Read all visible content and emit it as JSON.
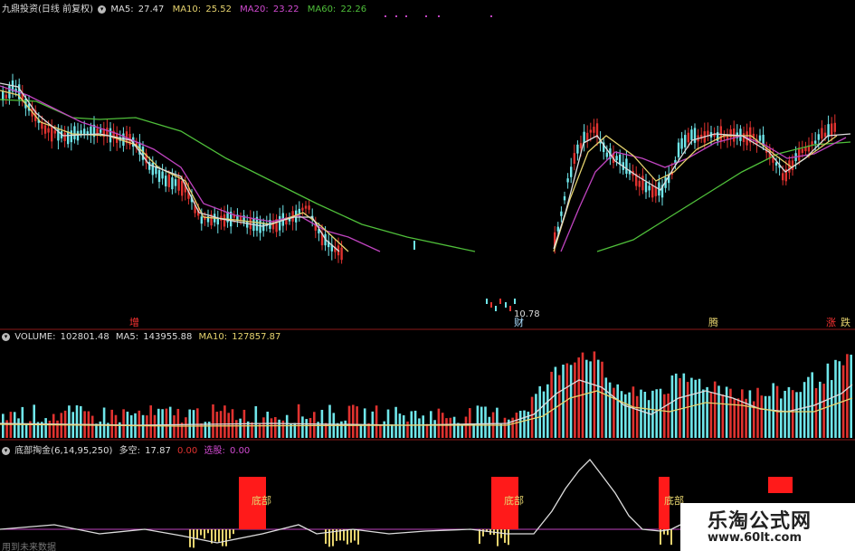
{
  "colors": {
    "ma5": "#dddddd",
    "ma10": "#e6d36e",
    "ma20": "#c044c0",
    "ma60": "#4fbf3a",
    "up": "#e0322f",
    "down": "#6fe6ea",
    "label": "#ff3333",
    "sep": "#8b1a1a"
  },
  "price_header": {
    "name": "九鼎投资(日线 前复权)",
    "ma5_label": "MA5:",
    "ma5_value": "27.47",
    "ma10_label": "MA10:",
    "ma10_value": "25.52",
    "ma20_label": "MA20:",
    "ma20_value": "23.22",
    "ma60_label": "MA60:",
    "ma60_value": "22.26"
  },
  "volume_header": {
    "label": "VOLUME:",
    "value": "102801.48",
    "ma5_label": "MA5:",
    "ma5_value": "143955.88",
    "ma10_label": "MA10:",
    "ma10_value": "127857.87"
  },
  "indicator_header": {
    "name": "底部掏金(6,14,95,250)",
    "duokong_label": "多空:",
    "duokong_value": "17.87",
    "v2": "0.00",
    "xuangu_label": "选股:",
    "xuangu_value": "0.00"
  },
  "indicator_footer": "用到未来数据",
  "watermark": {
    "line1": "乐淘公式网",
    "line2": "www.60lt.com"
  },
  "low_label": "10.78",
  "event_labels": [
    "增",
    "财",
    "腾",
    "涨",
    "跌"
  ],
  "chart_data": [
    {
      "type": "candlestick",
      "title": "九鼎投资(日线 前复权)",
      "series": [
        {
          "name": "MA5",
          "last": 27.47
        },
        {
          "name": "MA10",
          "last": 25.52
        },
        {
          "name": "MA20",
          "last": 23.22
        },
        {
          "name": "MA60",
          "last": 22.26
        }
      ],
      "annotations": [
        "10.78"
      ]
    },
    {
      "type": "bar",
      "title": "VOLUME",
      "series": [
        {
          "name": "VOLUME",
          "last": 102801.48
        },
        {
          "name": "MA5",
          "last": 143955.88
        },
        {
          "name": "MA10",
          "last": 127857.87
        }
      ]
    },
    {
      "type": "line",
      "title": "底部掏金(6,14,95,250)",
      "series": [
        {
          "name": "多空",
          "last": 17.87
        },
        {
          "name": "选股",
          "last": 0.0
        }
      ],
      "annotations": [
        "底部",
        "底部",
        "底部"
      ]
    }
  ],
  "bottom_labels": [
    "底部",
    "底部",
    "底部"
  ]
}
